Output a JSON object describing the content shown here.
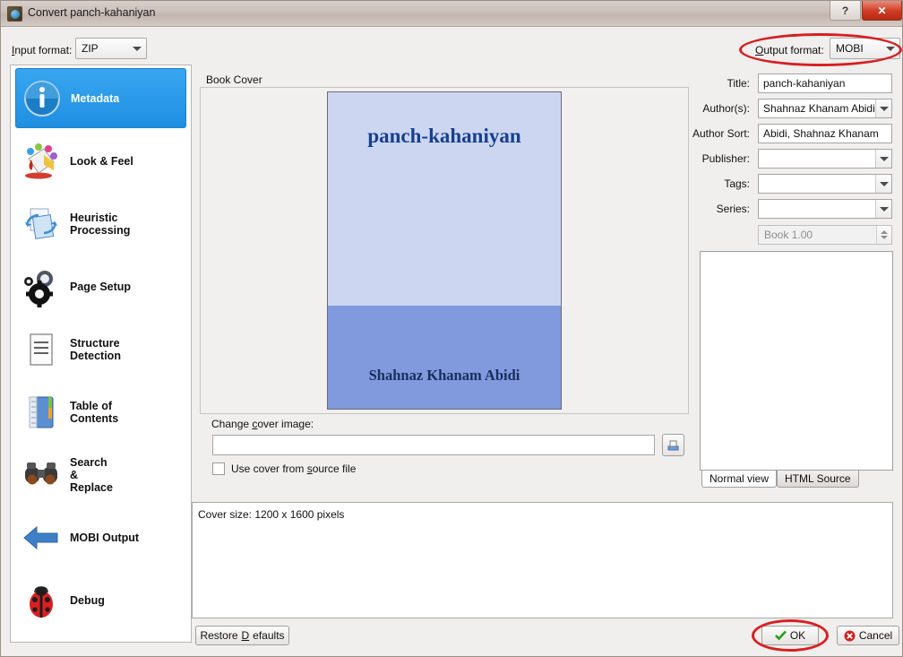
{
  "window": {
    "title": "Convert panch-kahaniyan",
    "icon": "calibre-app-icon",
    "help_label": "?",
    "close_label": "✕"
  },
  "toolbar": {
    "input_format_label": "Input format:",
    "input_format_value": "ZIP",
    "output_format_label": "Output format:",
    "output_format_value": "MOBI"
  },
  "sidebar": {
    "items": [
      {
        "label": "Metadata",
        "icon": "info-icon",
        "selected": true
      },
      {
        "label": "Look & Feel",
        "icon": "paint-bucket-icon",
        "selected": false
      },
      {
        "label": "Heuristic\nProcessing",
        "icon": "pages-swap-icon",
        "selected": false
      },
      {
        "label": "Page Setup",
        "icon": "gears-icon",
        "selected": false
      },
      {
        "label": "Structure\nDetection",
        "icon": "document-lines-icon",
        "selected": false
      },
      {
        "label": "Table of\nContents",
        "icon": "notebook-icon",
        "selected": false
      },
      {
        "label": "Search\n&\nReplace",
        "icon": "binoculars-icon",
        "selected": false
      },
      {
        "label": "MOBI Output",
        "icon": "left-arrow-icon",
        "selected": false
      },
      {
        "label": "Debug",
        "icon": "ladybug-icon",
        "selected": false
      }
    ]
  },
  "book_cover": {
    "group_label": "Book Cover",
    "cover_title": "panch-kahaniyan",
    "cover_author": "Shahnaz Khanam Abidi",
    "cover_bg_top": "#ccd6f0",
    "cover_bg_bottom": "#8199dd",
    "cover_text_color": "#173f8f",
    "change_cover_label": "Change cover image:",
    "change_cover_value": "",
    "browse_icon": "folder-open-icon",
    "use_source_cover_label": "Use cover from source file",
    "use_source_cover_checked": false
  },
  "metadata": {
    "fields": [
      {
        "label": "Title:",
        "value": "panch-kahaniyan",
        "has_dropdown": false
      },
      {
        "label": "Author(s):",
        "value": "Shahnaz Khanam Abidi",
        "has_dropdown": true
      },
      {
        "label": "Author Sort:",
        "value": "Abidi, Shahnaz Khanam",
        "has_dropdown": false
      },
      {
        "label": "Publisher:",
        "value": "",
        "has_dropdown": true
      },
      {
        "label": "Tags:",
        "value": "",
        "has_dropdown": true
      },
      {
        "label": "Series:",
        "value": "",
        "has_dropdown": true
      }
    ],
    "series_index_placeholder": "Book 1.00",
    "comments_value": "",
    "tabs": [
      {
        "label": "Normal view",
        "active": true
      },
      {
        "label": "HTML Source",
        "active": false
      }
    ]
  },
  "status": {
    "text": "Cover size: 1200 x 1600 pixels"
  },
  "footer": {
    "restore_defaults_label": "Restore Defaults",
    "ok_label": "OK",
    "cancel_label": "Cancel",
    "ok_icon": "green-check-icon",
    "cancel_icon": "red-x-circle-icon"
  },
  "annotations": {
    "highlight_color": "#d81f21",
    "marks": [
      "output-format-ellipse",
      "ok-button-ellipse"
    ]
  }
}
